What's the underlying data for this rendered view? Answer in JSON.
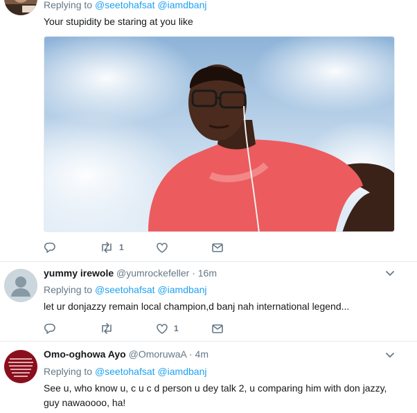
{
  "tweets": [
    {
      "replying_label": "Replying to",
      "reply_to": [
        "@seetohafsat",
        "@iamdbanj"
      ],
      "text": "Your stupidity be staring at you like",
      "actions": {
        "reply": "",
        "retweet": "1",
        "like": ""
      },
      "icons": [
        "reply-icon",
        "retweet-icon",
        "heart-icon",
        "message-icon"
      ]
    },
    {
      "display_name": "yummy irewole",
      "handle": "@yumrockefeller",
      "separator": "·",
      "time": "16m",
      "replying_label": "Replying to",
      "reply_to": [
        "@seetohafsat",
        "@iamdbanj"
      ],
      "text": "let ur donjazzy remain local champion,d banj nah international legend...",
      "actions": {
        "reply": "",
        "retweet": "",
        "like": "1"
      }
    },
    {
      "display_name": "Omo-oghowa Ayo",
      "handle": "@OmoruwaA",
      "separator": "·",
      "time": "4m",
      "replying_label": "Replying to",
      "reply_to": [
        "@seetohafsat",
        "@iamdbanj"
      ],
      "text_lines": [
        "See u, who know u, c u c d person u dey talk 2, u comparing him with don jazzy,",
        "guy nawaoooo, ha!"
      ]
    }
  ],
  "colors": {
    "link": "#1da1f2",
    "muted": "#657786",
    "border": "#e6ecf0",
    "text": "#14171a"
  }
}
